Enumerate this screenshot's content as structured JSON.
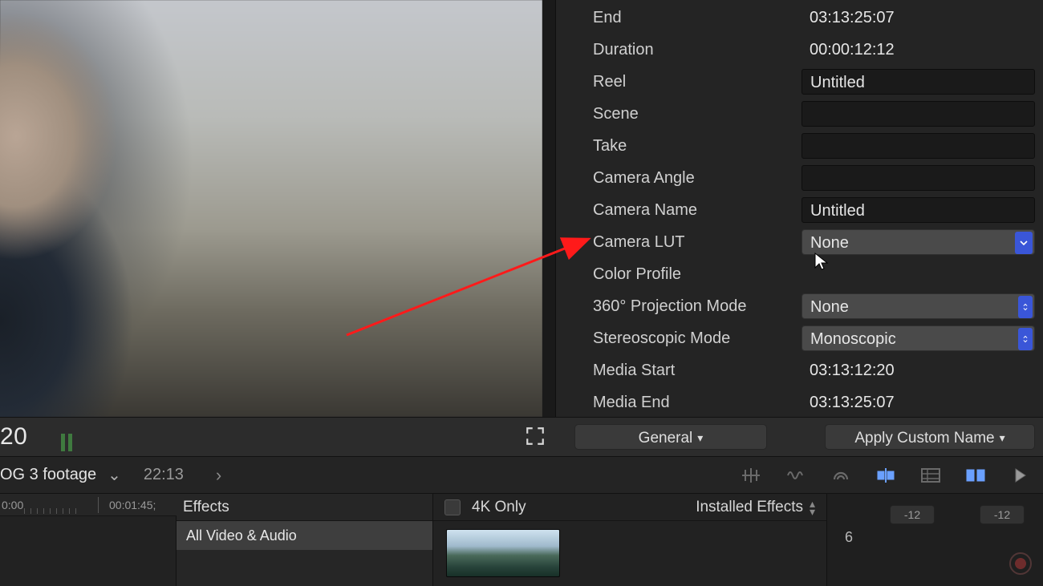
{
  "inspector": {
    "rows": {
      "end": {
        "label": "End",
        "value": "03:13:25:07"
      },
      "duration": {
        "label": "Duration",
        "value": "00:00:12:12"
      },
      "reel": {
        "label": "Reel",
        "value": "Untitled"
      },
      "scene": {
        "label": "Scene",
        "value": ""
      },
      "take": {
        "label": "Take",
        "value": ""
      },
      "camera_angle": {
        "label": "Camera Angle",
        "value": ""
      },
      "camera_name": {
        "label": "Camera Name",
        "value": "Untitled"
      },
      "camera_lut": {
        "label": "Camera LUT",
        "value": "None"
      },
      "color_profile": {
        "label": "Color Profile",
        "value": ""
      },
      "projection": {
        "label": "360° Projection Mode",
        "value": "None"
      },
      "stereo": {
        "label": "Stereoscopic Mode",
        "value": "Monoscopic"
      },
      "media_start": {
        "label": "Media Start",
        "value": "03:13:12:20"
      },
      "media_end": {
        "label": "Media End",
        "value": "03:13:25:07"
      }
    },
    "buttons": {
      "general": "General",
      "apply_custom_name": "Apply Custom Name"
    }
  },
  "viewer": {
    "timecode_fragment": "20"
  },
  "timeline_bar": {
    "project_name_fragment": "OG 3 footage",
    "duration": "22:13"
  },
  "ruler": {
    "t0": "0:00",
    "t1": "00:01:45;"
  },
  "effects": {
    "title": "Effects",
    "category": "All Video & Audio",
    "filter_4k": "4K Only",
    "scope": "Installed Effects"
  },
  "audio": {
    "db1": "-12",
    "db2": "-12",
    "scale": "6"
  }
}
